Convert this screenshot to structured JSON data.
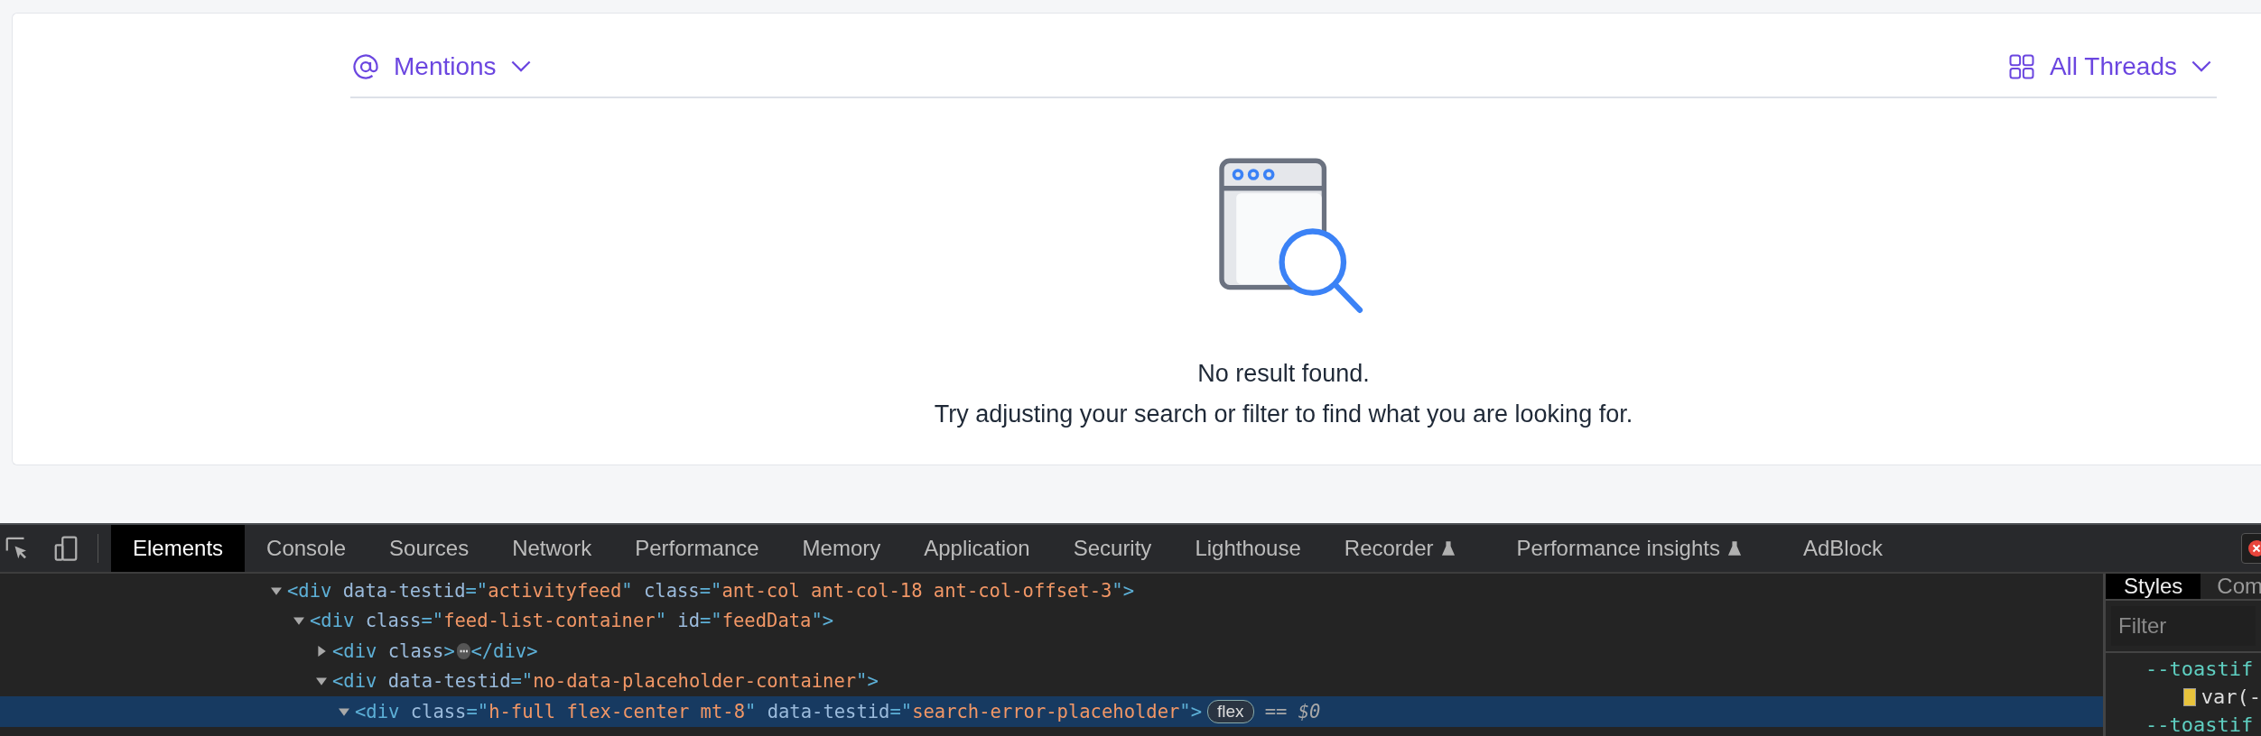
{
  "feed": {
    "filter": {
      "label": "Mentions"
    },
    "scope": {
      "label": "All Threads"
    },
    "empty": {
      "title": "No result found.",
      "message": "Try adjusting your search or filter to find what you are looking for."
    }
  },
  "devtools": {
    "tabs": [
      {
        "label": "Elements",
        "selected": true,
        "kind": "plain"
      },
      {
        "label": "Console",
        "selected": false,
        "kind": "plain"
      },
      {
        "label": "Sources",
        "selected": false,
        "kind": "plain"
      },
      {
        "label": "Network",
        "selected": false,
        "kind": "plain"
      },
      {
        "label": "Performance",
        "selected": false,
        "kind": "plain"
      },
      {
        "label": "Memory",
        "selected": false,
        "kind": "plain"
      },
      {
        "label": "Application",
        "selected": false,
        "kind": "plain"
      },
      {
        "label": "Security",
        "selected": false,
        "kind": "plain"
      },
      {
        "label": "Lighthouse",
        "selected": false,
        "kind": "plain"
      },
      {
        "label": "Recorder",
        "selected": false,
        "kind": "experimental"
      },
      {
        "label": "Performance insights",
        "selected": false,
        "kind": "experimental"
      },
      {
        "label": "AdBlock",
        "selected": false,
        "kind": "plain"
      }
    ],
    "tree": [
      {
        "tokens": [
          {
            "kind": "tag",
            "text": "<div"
          },
          {
            "kind": "attr",
            "text": " data-testid"
          },
          {
            "kind": "tag",
            "text": "=\""
          },
          {
            "kind": "value",
            "text": "activityfeed"
          },
          {
            "kind": "tag",
            "text": "\""
          },
          {
            "kind": "attr",
            "text": " class"
          },
          {
            "kind": "tag",
            "text": "=\""
          },
          {
            "kind": "value",
            "text": "ant-col ant-col-18 ant-col-offset-3"
          },
          {
            "kind": "tag",
            "text": "\">"
          }
        ],
        "expanded": true,
        "selected": false,
        "children": [
          {
            "tokens": [
              {
                "kind": "tag",
                "text": "<div"
              },
              {
                "kind": "attr",
                "text": " class"
              },
              {
                "kind": "tag",
                "text": "=\""
              },
              {
                "kind": "value",
                "text": "feed-list-container"
              },
              {
                "kind": "tag",
                "text": "\""
              },
              {
                "kind": "attr",
                "text": " id"
              },
              {
                "kind": "tag",
                "text": "=\""
              },
              {
                "kind": "value",
                "text": "feedData"
              },
              {
                "kind": "tag",
                "text": "\">"
              }
            ],
            "expanded": true,
            "selected": false,
            "children": [
              {
                "tokens": [
                  {
                    "kind": "tag",
                    "text": "<div"
                  },
                  {
                    "kind": "attr",
                    "text": " class"
                  },
                  {
                    "kind": "tag",
                    "text": ">"
                  }
                ],
                "expanded": false,
                "selected": false,
                "collapsed_badge": "⋯",
                "closing": "</div>"
              },
              {
                "tokens": [
                  {
                    "kind": "tag",
                    "text": "<div"
                  },
                  {
                    "kind": "attr",
                    "text": " data-testid"
                  },
                  {
                    "kind": "tag",
                    "text": "=\""
                  },
                  {
                    "kind": "value",
                    "text": "no-data-placeholder-container"
                  },
                  {
                    "kind": "tag",
                    "text": "\">"
                  }
                ],
                "expanded": true,
                "selected": false,
                "children": [
                  {
                    "tokens": [
                      {
                        "kind": "tag",
                        "text": "<div"
                      },
                      {
                        "kind": "attr",
                        "text": " class"
                      },
                      {
                        "kind": "tag",
                        "text": "=\""
                      },
                      {
                        "kind": "value",
                        "text": "h-full flex-center mt-8"
                      },
                      {
                        "kind": "tag",
                        "text": "\""
                      },
                      {
                        "kind": "attr",
                        "text": " data-testid"
                      },
                      {
                        "kind": "tag",
                        "text": "=\""
                      },
                      {
                        "kind": "value",
                        "text": "search-error-placeholder"
                      },
                      {
                        "kind": "tag",
                        "text": "\">"
                      }
                    ],
                    "expanded": true,
                    "selected": true,
                    "badge": "flex",
                    "suffix": "== $0"
                  }
                ]
              }
            ]
          }
        ]
      }
    ],
    "sidebar": {
      "tabs": [
        {
          "label": "Styles",
          "selected": true
        },
        {
          "label": "Com",
          "selected": false
        }
      ],
      "filter": {
        "placeholder": "Filter"
      },
      "lines": [
        {
          "kind": "property",
          "text": "--toastif"
        },
        {
          "kind": "swatch",
          "text": "var(-",
          "color": "#e8c33c"
        },
        {
          "kind": "property",
          "text": "--toastif"
        }
      ]
    }
  }
}
